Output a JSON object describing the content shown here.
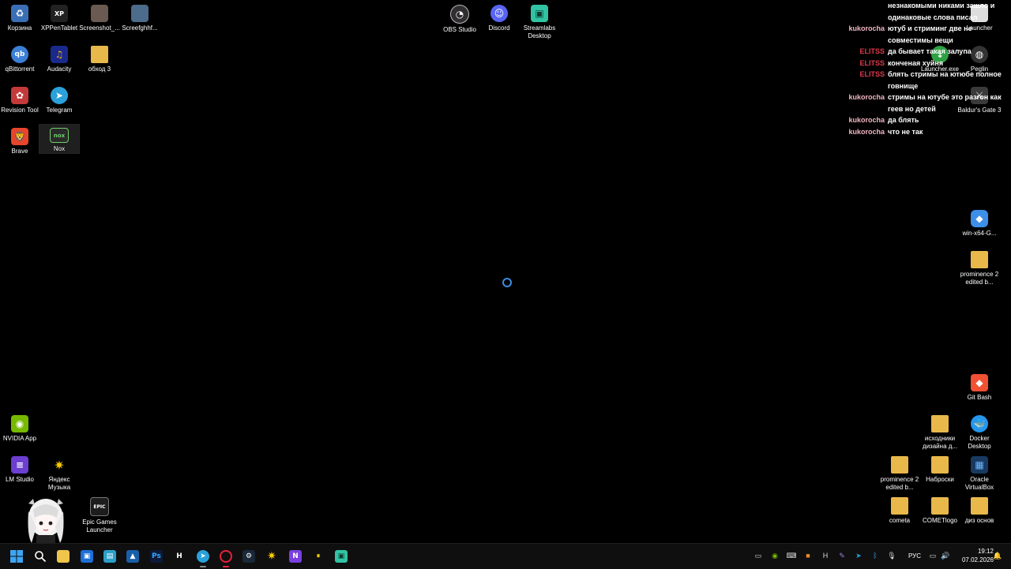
{
  "desktop_icons": {
    "recycle_bin": "Корзина",
    "xppen": "XPPenTablet",
    "screenshot": "Screenshot_...",
    "screefghhf": "Screefghhf...",
    "obs": "OBS Studio",
    "discord": "Discord",
    "streamlabs": "Streamlabs Desktop",
    "qbittorrent": "qBittorrent",
    "audacity": "Audacity",
    "obhod": "обход 3",
    "revision": "Revision Tool",
    "telegram": "Telegram",
    "brave": "Brave",
    "nox": "Nox",
    "nvidia": "NVIDIA App",
    "lmstudio": "LM Studio",
    "yandex_music": "Яндекс Музыка",
    "epic": "Epic Games Launcher",
    "launcher": "Launcher",
    "launcher_exe": "Launcher.exe",
    "peglin": "Peglin",
    "baldurs_gate": "Baldur's Gate 3",
    "win_x64": "win-x64-G...",
    "prominence_right": "prominence 2 edited b...",
    "git_bash": "Git Bash",
    "iskhodniki": "исходники дизайна д...",
    "docker": "Docker Desktop",
    "prominence_bottom": "prominence 2 edited b...",
    "nabroski": "Наброски",
    "virtualbox": "Oracle VirtualBox",
    "cometa": "cometa",
    "cometlogo": "COMETlogo",
    "diz_osnov": "диз основ"
  },
  "chat": [
    {
      "user": "",
      "role": "",
      "msg": "незнакомыми никами зашло и одинаковые слова писал"
    },
    {
      "user": "kukorocha",
      "role": "kuk",
      "msg": "ютуб и стриминг две не совместимы вещи"
    },
    {
      "user": "ELITSS",
      "role": "eli",
      "msg": "да бывает такая залупа"
    },
    {
      "user": "ELITSS",
      "role": "eli",
      "msg": "конченая хуйня"
    },
    {
      "user": "ELITSS",
      "role": "eli",
      "msg": "блять стримы на ютюбе полное говнище"
    },
    {
      "user": "kukorocha",
      "role": "kuk",
      "msg": "стримы на ютубе это разгон как геев но детей"
    },
    {
      "user": "kukorocha",
      "role": "kuk",
      "msg": "да блять"
    },
    {
      "user": "kukorocha",
      "role": "kuk",
      "msg": "что не так"
    }
  ],
  "taskbar": {
    "language": "РУС",
    "time": "19:12",
    "date": "07.02.2026"
  },
  "colors": {
    "desktop_bg": "#000000",
    "taskbar_bg": "#0f0f0f",
    "chat_user_kukorocha": "#f0b6c2",
    "chat_user_elitss": "#e13a4b",
    "spinner": "#3b8ee0"
  }
}
